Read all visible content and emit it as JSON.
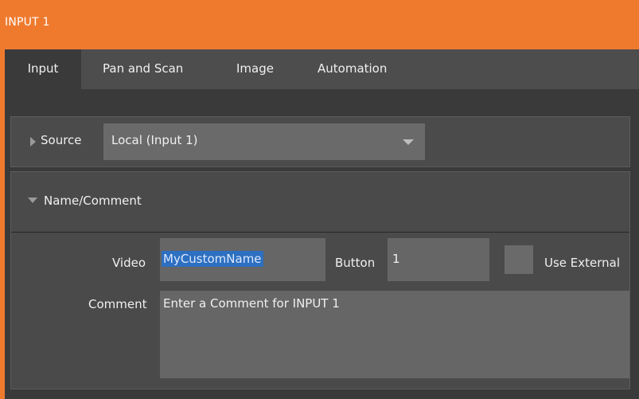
{
  "window": {
    "title": "INPUT 1"
  },
  "tabs": [
    {
      "label": "Input",
      "active": true
    },
    {
      "label": "Pan and Scan",
      "active": false
    },
    {
      "label": "Image",
      "active": false
    },
    {
      "label": "Automation",
      "active": false
    }
  ],
  "source": {
    "label": "Source",
    "selected": "Local (Input 1)"
  },
  "name_comment": {
    "header": "Name/Comment",
    "video_label": "Video",
    "video_value": "MyCustomName",
    "button_label": "Button",
    "button_value": "1",
    "use_external_label": "Use External",
    "use_external_checked": false,
    "comment_label": "Comment",
    "comment_placeholder": "Enter a Comment for INPUT 1"
  },
  "colors": {
    "accent": "#ef7a2e",
    "panel": "#4b4b4b",
    "field": "#666666",
    "selection": "#2d6fc0"
  }
}
